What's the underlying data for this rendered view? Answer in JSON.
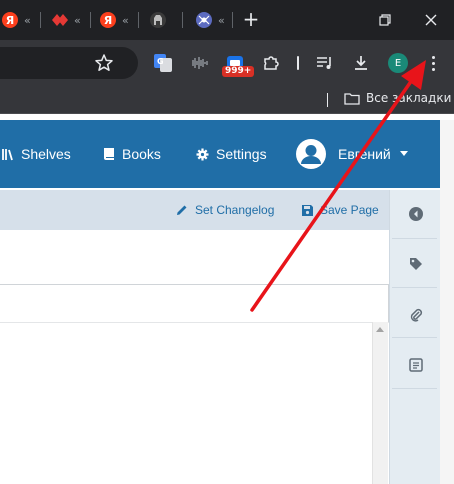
{
  "browser": {
    "tabs": [
      {
        "icon": "yandex-icon",
        "text": "«"
      },
      {
        "icon": "red-diamond-icon",
        "text": "«"
      },
      {
        "icon": "yandex-icon",
        "text": "«"
      },
      {
        "icon": "github-icon",
        "text": ""
      },
      {
        "icon": "spider-icon",
        "text": "«"
      }
    ],
    "extension_badge": "999+",
    "profile_initial": "E",
    "bookmarks_folder": "Все закладки"
  },
  "app": {
    "nav": {
      "shelves": "Shelves",
      "books": "Books",
      "settings": "Settings"
    },
    "user_name": "Евгений"
  },
  "editor": {
    "set_changelog": "Set Changelog",
    "save_page": "Save Page"
  },
  "colors": {
    "header": "#206ea7",
    "annotation": "#e8141a"
  }
}
